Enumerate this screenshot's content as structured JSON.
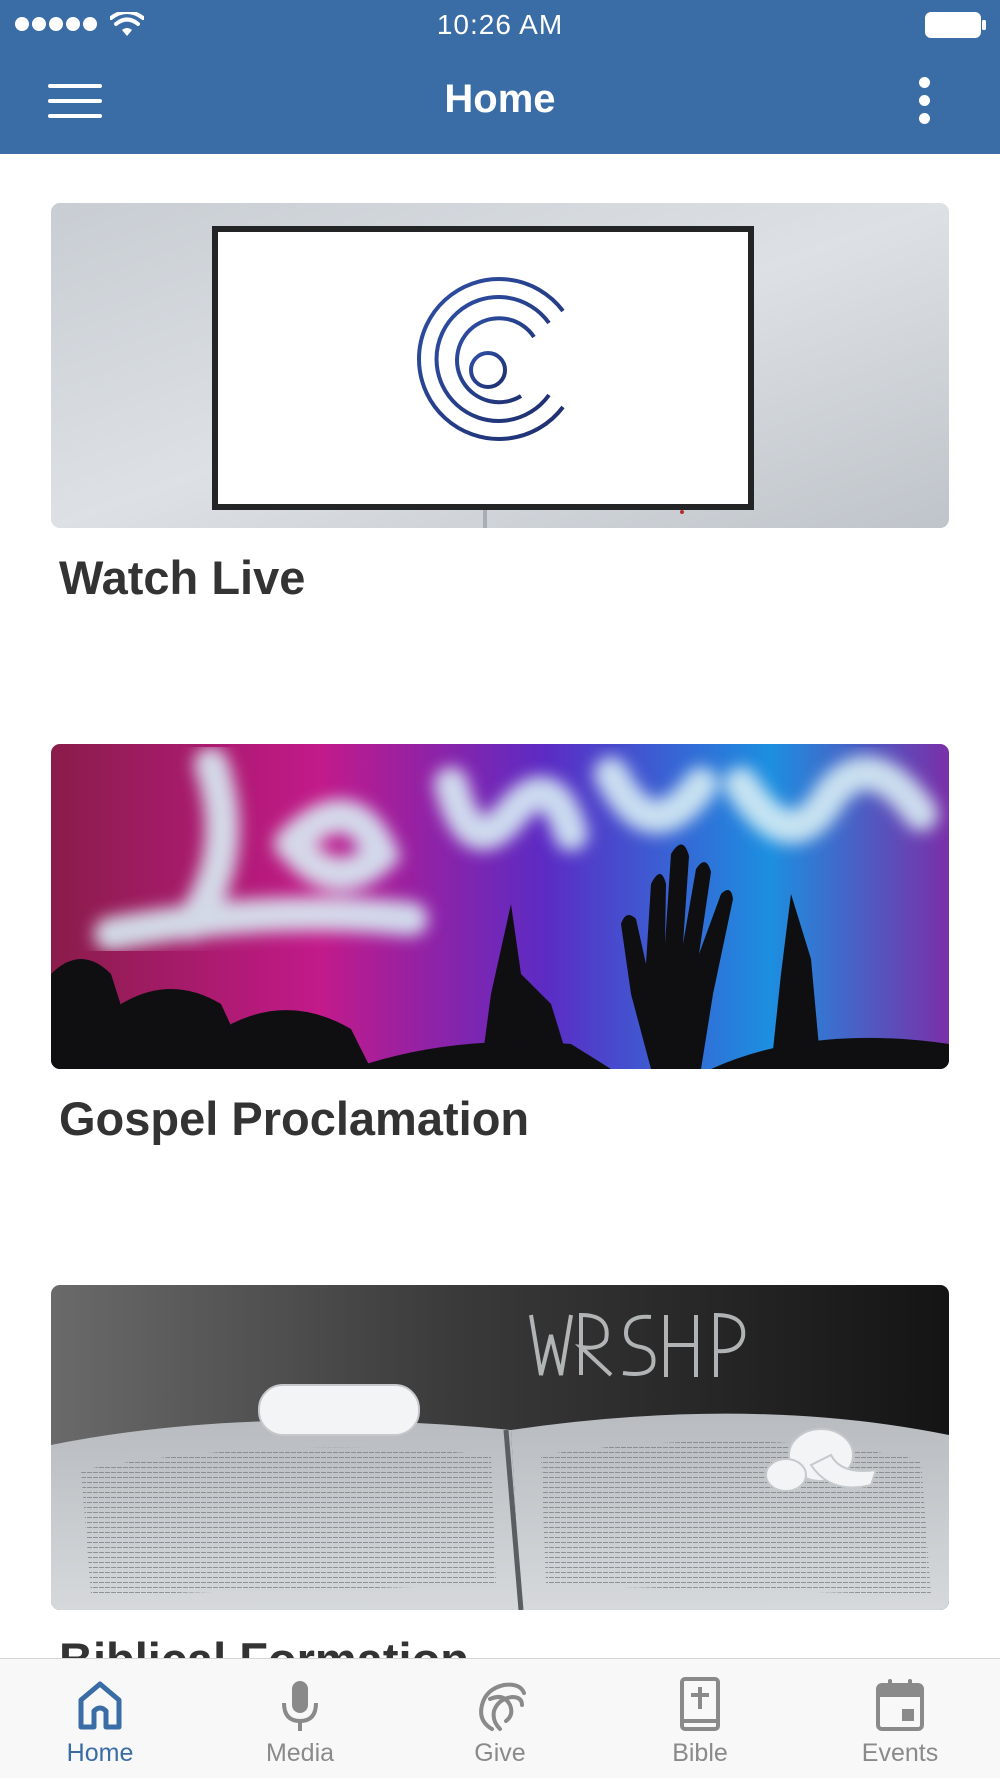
{
  "status_bar": {
    "time": "10:26 AM"
  },
  "nav": {
    "title": "Home",
    "left_icon": "hamburger-menu-icon",
    "right_icon": "more-vertical-icon"
  },
  "cards": [
    {
      "title": "Watch Live",
      "image": "tv-screen-with-church-logo"
    },
    {
      "title": "Gospel Proclamation",
      "image": "raised-hands-jesus-neon"
    },
    {
      "title": "Biblical Formation",
      "image": "open-bible-with-earbuds"
    }
  ],
  "tabs": [
    {
      "label": "Home",
      "icon": "home-icon",
      "active": true
    },
    {
      "label": "Media",
      "icon": "microphone-icon",
      "active": false
    },
    {
      "label": "Give",
      "icon": "give-icon",
      "active": false
    },
    {
      "label": "Bible",
      "icon": "bible-icon",
      "active": false
    },
    {
      "label": "Events",
      "icon": "calendar-icon",
      "active": false
    }
  ],
  "colors": {
    "header": "#3a6ca6",
    "tab_active": "#3a6ca6",
    "tab_inactive": "#8a8a8a",
    "title_text": "#333333"
  }
}
